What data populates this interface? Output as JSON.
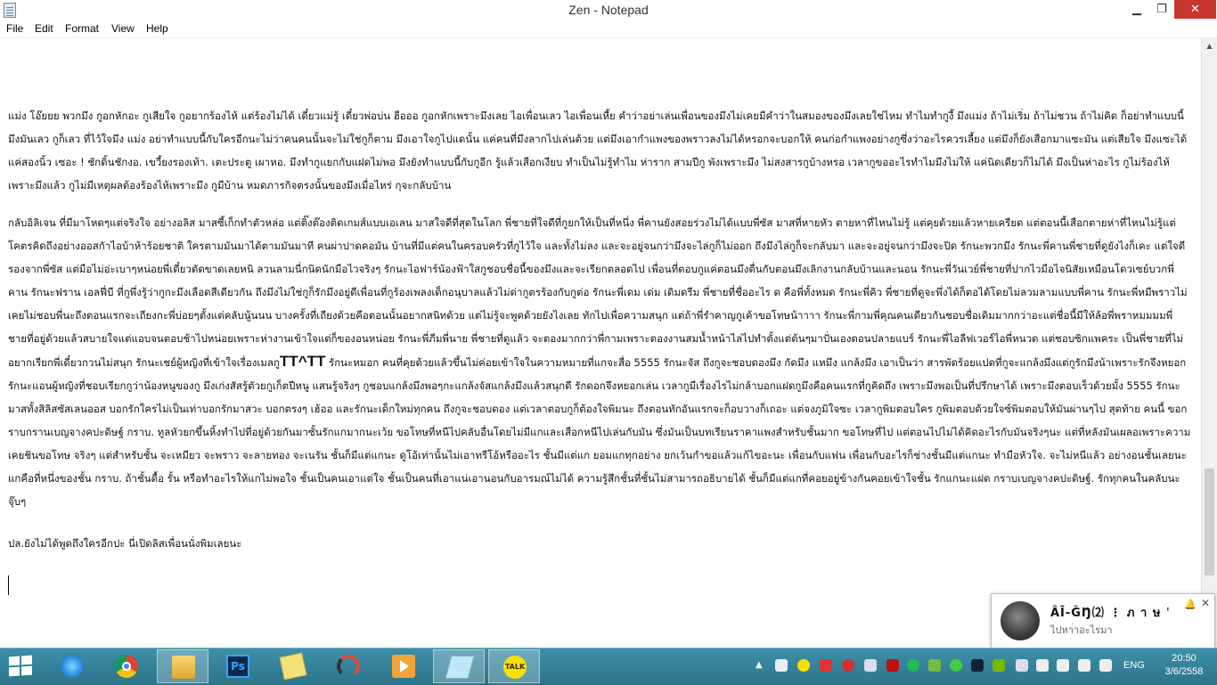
{
  "window": {
    "title": "Zen - Notepad",
    "minimize_glyph": "▁",
    "maximize_glyph": "❐",
    "close_glyph": "✕"
  },
  "menu": [
    "File",
    "Edit",
    "Format",
    "View",
    "Help"
  ],
  "document": {
    "paragraphs": [
      "แม่ง โอ๊ยยย พวกมึง กูอกหักอะ กูเสียใจ กูอยากร้องไห้ แต่ร้องไม่ได้ เดี๋ยวแม่รู้ เดี๋ยวพ่อบ่น ฮือออ กูอกหักเพราะมึงเลย ไอเพื่อนเลว ไอเพื่อนเหี้ย คำว่าอย่าเล่นเพื่อนของมึงไม่เคยมีคำว่าในสมองของมึงเลยใช่ไหม ทำไมทำกูงี้ มึงแม่ง ถ้าไม่เริ่ม ถ้าไม่ชวน ถ้าไม่คิด ก็อย่าทำแบบนี้ มึงมันเลว กูก็เลว ที่ไว้ใจมึง แม่ง อย่าทำแบบนี้กับใครอีกนะไม่ว่าคนคนนั้นจะไม่ใช่กูก็ตาม มึงเอาใจกูไปแดนั้น แค่คนที่มึงลากไปเล่นด้วย แต่มึงเอากำแพงของพราวลงไม่ได้หรอกจะบอกให้ คนก่อกำแพงอย่างกูซึ่งว่าอะไรควรเลี้ยง แต่มึงก็ยังเสือกมาแซะมัน แต่เสียใจ มึงแซะได้แค่สองนิ้ว เซอะ ! ชักดิ้นชักงอ. เขวี้ยงรองเท้า. เตะประตู เผาหอ. มึงทำกูแยกกับแฝดไม่พอ มึงยังทำแบบนี้กับกูอีก รู้แล้วเสือกเงียบ ทำเป็นไม่รู้ทำไม ห่าราก สามปีกู พังเพราะมึง ไม่สงสารกูบ้างหรอ เวลากูขออะไรทำไมมึงไม่ให้ แค่นิดเดียวก็ไม่ได้ มึงเป็นห่าอะไร กูไม่ร้องไห้เพราะมึงแล้ว กูไม่มีเหตุผลต้องร้องไห้เพราะมึง กูมีบ้าน หมดภารกิจตรงนั้นของมึงเมื่อไหร่ กุจะกลับบ้าน",
      "กลับอิลิเจน ที่มีมาโหดๆแต่จริงใจ อย่างอลิส มาสซี้เก็กทำตัวหล่อ แต่ติ๊งต๊องติดเกมส์แบบเอเลน มาสใจดีที่สุดในโลก พี่ชายที่ใจดีที่กูยกให้เป็นที่หนึ่ง พี่คานยังสอยร่วงไม่ได้แบบพี่ซัส มาสที่หายหัว ตายหาที่ไหนไม่รู้ แต่คุยด้วยแล้วหายเครียด แต่ตอนนี้เสือกตายห่าที่ไหนไม่รู้แต่โคตรคิดถึงอย่างออสกัาไอบ้าห้าร้อยชาติ ใครตามมันมาได้ตามมันมาที คนผ่าปาดคอมัน บ้านที่มีแต่คนในครอบครัวที่กูไว้ใจ และทั้งไม่ลง และจะอยู่จนกว่ามึงจะไล่กูก็ไม่ออก ถึงมึงไล่กูก็จะกลับมา และจะอยู่จนกว่ามึงจะปิด รักนะพวกมึง รักนะพี่คานพี่ชายที่ดูยังไงก็เคะ แต่ใจดีรองจากพี่ซัส แต่มือไม่อ่ะเบาๆหน่อยพี่เดี๋ยวตัดขาดเลยหนิ ลวนลามนี่กนิดนักมือไวจริงๆ รักนะไอฟาร์น้องฟ้าใสกูชอบชื่อนี้ของมึงและจะเรียกตลอดไป เพื่อนที่ตอบกูแค่ตอนมึงตื่นกับตอนมึงเลิกงานกลับบ้านและนอน รักนะพี่วันเวย์พี่ชายที่ปากไวมือไจนิสัยเหมือนโดวเซย์บวกพี่คาน รักนะฟราน เอลฟี่บี ที่กูพึ่งรู้ว่ากูกะมึงเลือดสีเดียวกัน ถึงมึงไม่ใช่กูก็รักมึงอยู่ดีเพื่อนที่กูร้องเพลงเด็กอนุบาลแล้วไม่ด่ากูตรร้องกับกูต่อ รักนะพี่เดม เด่ม เดิมดรีม พี่ชายที่ชื่ออะไร ด คือพี่ทั้งหมด รักนะพี่คิว พี่ชายที่ดูจะพึ่งได้ก็ตอได้โดยไม่ลวมลามแบบพี่คาน รักนะพี่หมีพราวไม่เคยไม่ชอบพี่นะถึงตอนแรกจะเถียงกะพี่บ่อยๆตั้งแต่คลับนู้นนน บางครั้งที่เถียงด้วยคือตอนนั้นอยากสนิทด้วย แต่ไม่รู้จะพูดด้วยยังไงเลย ทักไปเพื่อความสนุก แต่ถ้าพี่รำคาญกูเค้าขอโทษน้าาาา รักนะพี่กามพี่คุณคนเดียวกันชอบชื่อเดิมมากกว่าอะแต่ชื่อนี้มีให้ล้อพี่พราหมมมมพี่ชายที่อยู่ด้วยแล้วสบายใจแต่แอบจนตอบช้าไปหน่อยเพราะห่างานเข้าใจแต่ก็ของอนหน่อย รักนะพี่ภีมพี่นาย พี่ชายที่ดูแล้ว จะตองมากกว่าพี่กามเพราะตองงานสมน้ำหน้าไล่ไปทำตั้งแต่ต้นๆมาปั่นเองตอนปลายแบร์ รักนะพี่ไอลีฟเวอร์ไอพี่หนวด แต่ชอบซิกแพคระ เป็นพี่ชายที่ไม่อยากเรียกพี่เดี๋ยวกวนไม่สนุก รักนะเชย์ผู้หญิงที่เข้าใจเรื่องเมลกู",
      "ปล.ยังไม่ได้พูดถึงใครอีกปะ นี่เปิดลิสเพื่อนนั่งพิมเลยนะ"
    ],
    "emote": "TT^TT",
    "continuation": "รักนะหมอก คนที่คุยด้วยแล้วขึ้นไม่ค่อยเข้าใจในความหมายที่แกจะสื่อ 5555 รักนะจัส ถึงกูจะชอบดองมึง กัดมึง แหมึง แกล้งมึง เอาเป็นว่า สารพัดร้อยแปดที่กูจะแกล้งมึงแต่กูรักมึงน้าเพราะรักจึงหยอก รักนะแอนผู้หญิงที่ชอบเรียกกูว่าน้องหนูของกู มึงเก่งสัสรู้ตัวยกูเก็ตปีหนู แสนรู้จริงๆ กูชอบแกล้งมึงพอๆกะแกล้งจัสแกล้งมึงแล้วสนุกดี รักดอกจึงหยอกเล่น เวลากูมีเรื่องไรไม่กล้าบอกแฝดกูมึงคือคนแรกที่กูคิดถึง เพราะมึงพอเป็นที่ปรึกษาได้ เพราะมึงตอบเร็วด้วยมั้ง 5555 รักนะมาสทั้งสิลิสซัสเลนออส บอกรักใครไม่เป็นเท่าบอกรักมาสวะ บอกตรงๆ เฮ้ออ และรักนะเด็กใหม่ทุกคน ถึงกูจะชอบดอง แต่เวลาตอบกูก็ต้องใจพิมนะ ถึงตอนทักอันแรกจะก็อบวางก็เถอะ แต่จงภูมิใจซะ เวลากูพิมตอบใคร  กูพิมตอบด้วยใจซ์พิมตอบให้มันผ่านๆไป สุดท้าย คนนี้ ขอกราบกรานเบญจางคปะดิษฐ์ กราบ. ทูลหัวยกขึ้นหิ้งทำไปที่อยู่ด้วยกันมาซั้นรักแกมากนะเว้ย ขอโทษที่หนีไปคลับอื่นโดยไม่มีแกและเสือกหนีไปเล่นกับมัน ซึ่งมันเป็นบทเรียนราคาแพงสำหรับชั้นมาก ขอโทษที่ไป แต่ตอนไปไม่ได้คิดอะไรกับมันจริงๆนะ แต่ที่หลังมันเผลอเพราะความเคยชินขอโทษ จริงๆ แต่สำหรับชั้น จะเหมียว จะพราว จะลายทอง จะเนรัน ชั้นก็มีแต่แกนะ ดูโอ้เท่านั้นไม่เอาทรีโอ้หรืออะไร ชั้นมีแต่แก ยอมแกทุกอย่าง ยกเว้นกำขอแล้วแก้ไขอะนะ เพื่อนกับแฟน เพื่อนกับอะไรก็ช่างชั้นมีแต่แกนะ ทำมือหัวใจ. จะไม่หนีแล้ว อย่างอนชั้นเลยนะ แกคือที่หนึ่งของชั้น กราบ. ถ้าชั้นดื้อ รั้น หรือทำอะไรให้แกไม่พอใจ ชั้นเป็นคนเอาแต่ใจ ชั้นเป็นคนที่เอาแน่เอานอนกับอารมณ์ไม่ได้ ความรู้สึกชั้นที่ชั้นไม่สามารถอธิบายได้ ชั้นก็มีแต่แกที่คอยอยู่ข้างกันคอยเข้าใจชั้น รักแกนะแฝด กราบเบญจางคปะดิษฐ์. รักทุกคนในคลับนะจุ๊บๆ"
  },
  "notification": {
    "name": "ÂĪ-ĞŊ⑵ ⋮ ภ า ษ ˈ",
    "message": "ไปหา่าอะไรมา",
    "bell": "🔔",
    "close": "✕"
  },
  "taskbar": {
    "apps": [
      "internet-explorer",
      "chrome",
      "file-explorer",
      "photoshop",
      "sticky-notes",
      "arc-app",
      "media-player",
      "notepad",
      "kakaotalk"
    ],
    "ps_label": "Ps",
    "talk_label": "TALK",
    "tray_overflow": "▲",
    "language": "ENG",
    "time": "20:50",
    "date": "3/6/2558"
  }
}
